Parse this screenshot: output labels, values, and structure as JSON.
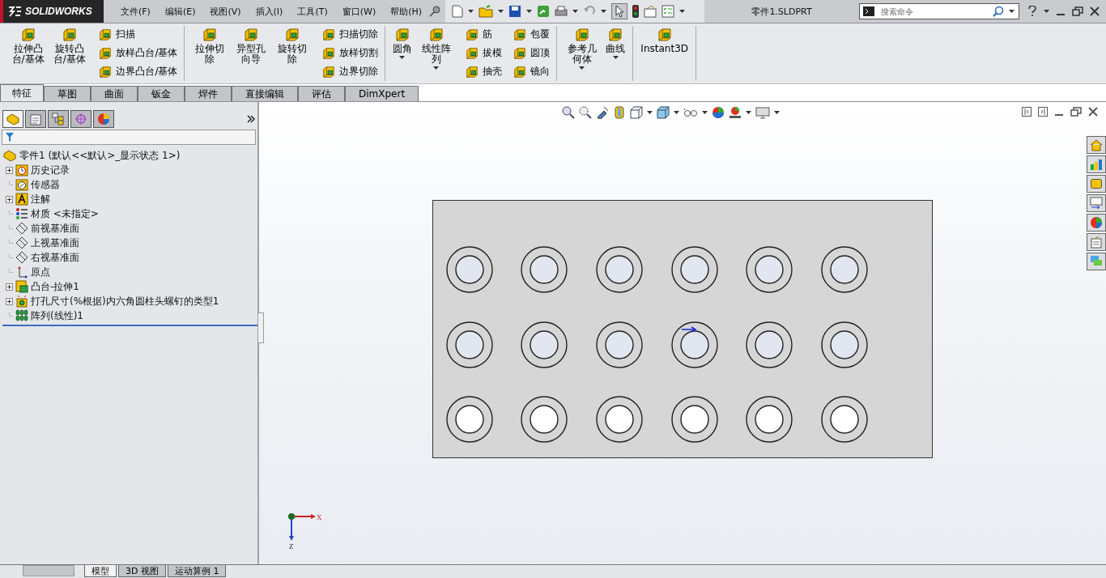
{
  "app": {
    "logo": "SOLIDWORKS"
  },
  "menu": [
    "文件(F)",
    "编辑(E)",
    "视图(V)",
    "插入(I)",
    "工具(T)",
    "窗口(W)",
    "帮助(H)"
  ],
  "document_title": "零件1.SLDPRT",
  "search": {
    "placeholder": "搜索命令"
  },
  "ribbon_groups": [
    {
      "items": [
        {
          "kind": "large",
          "label": "拉伸凸台/基体",
          "menu": false
        },
        {
          "kind": "large",
          "label": "旋转凸台/基体",
          "menu": false
        },
        {
          "kind": "stack",
          "labels": [
            "扫描",
            "放样凸台/基体",
            "边界凸台/基体"
          ]
        }
      ]
    },
    {
      "items": [
        {
          "kind": "large",
          "label": "拉伸切除",
          "menu": false
        },
        {
          "kind": "large",
          "label": "异型孔向导",
          "menu": false
        },
        {
          "kind": "large",
          "label": "旋转切除",
          "menu": false
        },
        {
          "kind": "stack",
          "labels": [
            "扫描切除",
            "放样切割",
            "边界切除"
          ]
        }
      ]
    },
    {
      "items": [
        {
          "kind": "large",
          "label": "圆角",
          "menu": true
        },
        {
          "kind": "large",
          "label": "线性阵列",
          "menu": true
        },
        {
          "kind": "stack",
          "labels": [
            "筋",
            "拔模",
            "抽壳"
          ]
        },
        {
          "kind": "stack",
          "labels": [
            "包覆",
            "圆顶",
            "镜向"
          ]
        }
      ]
    },
    {
      "items": [
        {
          "kind": "large",
          "label": "参考几何体",
          "menu": true
        },
        {
          "kind": "large",
          "label": "曲线",
          "menu": true
        }
      ]
    },
    {
      "items": [
        {
          "kind": "wide",
          "label": "Instant3D",
          "menu": false
        }
      ]
    }
  ],
  "tabs": [
    {
      "label": "特征",
      "selected": true
    },
    {
      "label": "草图",
      "selected": false
    },
    {
      "label": "曲面",
      "selected": false
    },
    {
      "label": "钣金",
      "selected": false
    },
    {
      "label": "焊件",
      "selected": false
    },
    {
      "label": "直接编辑",
      "selected": false
    },
    {
      "label": "评估",
      "selected": false
    },
    {
      "label": "DimXpert",
      "selected": false
    }
  ],
  "panel_tabs": [
    {
      "kind": "features",
      "selected": true
    },
    {
      "kind": "properties",
      "selected": false
    },
    {
      "kind": "configurations",
      "selected": false
    },
    {
      "kind": "dimxpert",
      "selected": false
    },
    {
      "kind": "display",
      "selected": false
    }
  ],
  "tree": {
    "label": "零件1  (默认<<默认>_显示状态 1>)",
    "children": [
      {
        "kind": "history",
        "label": "历史记录",
        "expandable": true
      },
      {
        "kind": "sensor",
        "label": "传感器",
        "expandable": false
      },
      {
        "kind": "annotation",
        "label": "注解",
        "expandable": true
      },
      {
        "kind": "material",
        "label": "材质 <未指定>",
        "expandable": false
      },
      {
        "kind": "plane",
        "label": "前视基准面",
        "expandable": false
      },
      {
        "kind": "plane",
        "label": "上视基准面",
        "expandable": false
      },
      {
        "kind": "plane",
        "label": "右视基准面",
        "expandable": false
      },
      {
        "kind": "origin",
        "label": "原点",
        "expandable": false
      },
      {
        "kind": "extrude",
        "label": "凸台-拉伸1",
        "expandable": true
      },
      {
        "kind": "hole",
        "label": "打孔尺寸(%根据)内六角圆柱头螺钉的类型1",
        "expandable": true
      },
      {
        "kind": "pattern",
        "label": "阵列(线性)1",
        "expandable": false
      }
    ]
  },
  "triad": {
    "x_label": "X",
    "z_label": "Z"
  },
  "bottom_tabs": [
    {
      "label": "模型",
      "selected": true
    },
    {
      "label": "3D 视图",
      "selected": false
    },
    {
      "label": "运动算例 1",
      "selected": false
    }
  ]
}
